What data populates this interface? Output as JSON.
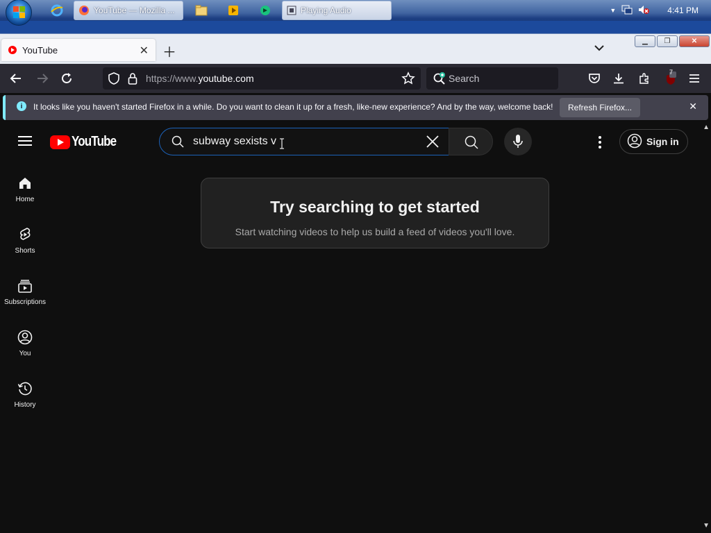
{
  "taskbar": {
    "start_label": "Start",
    "firefox_task": "YouTube — Mozilla ...",
    "audio_task": "Playing Audio",
    "clock": "4:41 PM"
  },
  "browser": {
    "tab_title": "YouTube",
    "url_scheme": "https://www.",
    "url_domain": "youtube.com",
    "search_placeholder": "Search",
    "extension_badge": "7",
    "notice_message": "It looks like you haven't started Firefox in a while. Do you want to clean it up for a fresh, like-new experience? And by the way, welcome back!",
    "refresh_button": "Refresh Firefox..."
  },
  "youtube": {
    "logo_text": "YouTube",
    "search_query": "subway sexists v",
    "sign_in": "Sign in",
    "guide": [
      {
        "label": "Home",
        "icon": "home-icon"
      },
      {
        "label": "Shorts",
        "icon": "shorts-icon"
      },
      {
        "label": "Subscriptions",
        "icon": "subscriptions-icon"
      },
      {
        "label": "You",
        "icon": "you-icon"
      },
      {
        "label": "History",
        "icon": "history-icon"
      }
    ],
    "empty_title": "Try searching to get started",
    "empty_subtitle": "Start watching videos to help us build a feed of videos you'll love."
  },
  "colors": {
    "yt_red": "#ff0000",
    "yt_bg": "#0f0f0f",
    "search_focus": "#1c62b9",
    "notice_accent": "#80ebff"
  }
}
